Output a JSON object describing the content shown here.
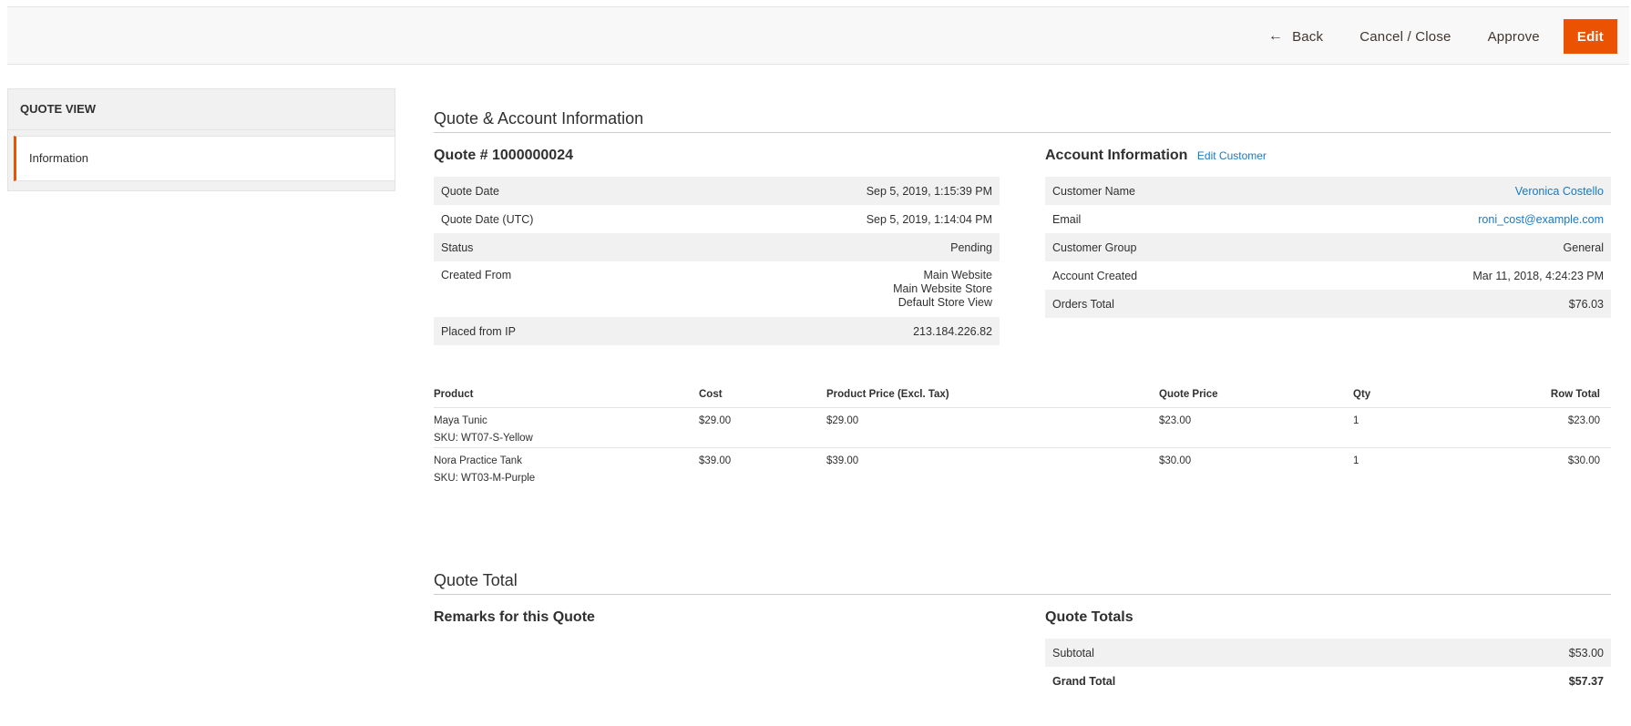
{
  "header": {
    "back_label": "Back",
    "cancel_label": "Cancel / Close",
    "approve_label": "Approve",
    "edit_label": "Edit"
  },
  "sidebar": {
    "title": "QUOTE VIEW",
    "items": [
      {
        "label": "Information"
      }
    ]
  },
  "main": {
    "section_title": "Quote & Account Information",
    "quote": {
      "title": "Quote # 1000000024",
      "rows": [
        {
          "label": "Quote Date",
          "value": "Sep 5, 2019, 1:15:39 PM"
        },
        {
          "label": "Quote Date (UTC)",
          "value": "Sep 5, 2019, 1:14:04 PM"
        },
        {
          "label": "Status",
          "value": "Pending"
        },
        {
          "label": "Created From",
          "value_lines": [
            "Main Website",
            "Main Website Store",
            "Default Store View"
          ]
        },
        {
          "label": "Placed from IP",
          "value": "213.184.226.82"
        }
      ]
    },
    "account": {
      "title": "Account Information",
      "edit_link": "Edit Customer",
      "rows": [
        {
          "label": "Customer Name",
          "value": "Veronica Costello"
        },
        {
          "label": "Email",
          "value": "roni_cost@example.com"
        },
        {
          "label": "Customer Group",
          "value": "General"
        },
        {
          "label": "Account Created",
          "value": "Mar 11, 2018, 4:24:23 PM"
        },
        {
          "label": "Orders Total",
          "value": "$76.03"
        }
      ]
    },
    "items": {
      "headers": [
        "Product",
        "Cost",
        "Product Price (Excl. Tax)",
        "Quote Price",
        "Qty",
        "Row Total"
      ],
      "rows": [
        {
          "product": "Maya Tunic",
          "sku": "SKU: WT07-S-Yellow",
          "cost": "$29.00",
          "price": "$29.00",
          "quote_price": "$23.00",
          "qty": "1",
          "row_total": "$23.00"
        },
        {
          "product": "Nora Practice Tank",
          "sku": "SKU: WT03-M-Purple",
          "cost": "$39.00",
          "price": "$39.00",
          "quote_price": "$30.00",
          "qty": "1",
          "row_total": "$30.00"
        }
      ]
    },
    "totals_section": {
      "title": "Quote Total",
      "remarks_title": "Remarks for this Quote",
      "totals_title": "Quote Totals",
      "rows": [
        {
          "label": "Subtotal",
          "value": "$53.00"
        },
        {
          "label": "Grand Total",
          "value": "$57.37"
        }
      ]
    }
  }
}
